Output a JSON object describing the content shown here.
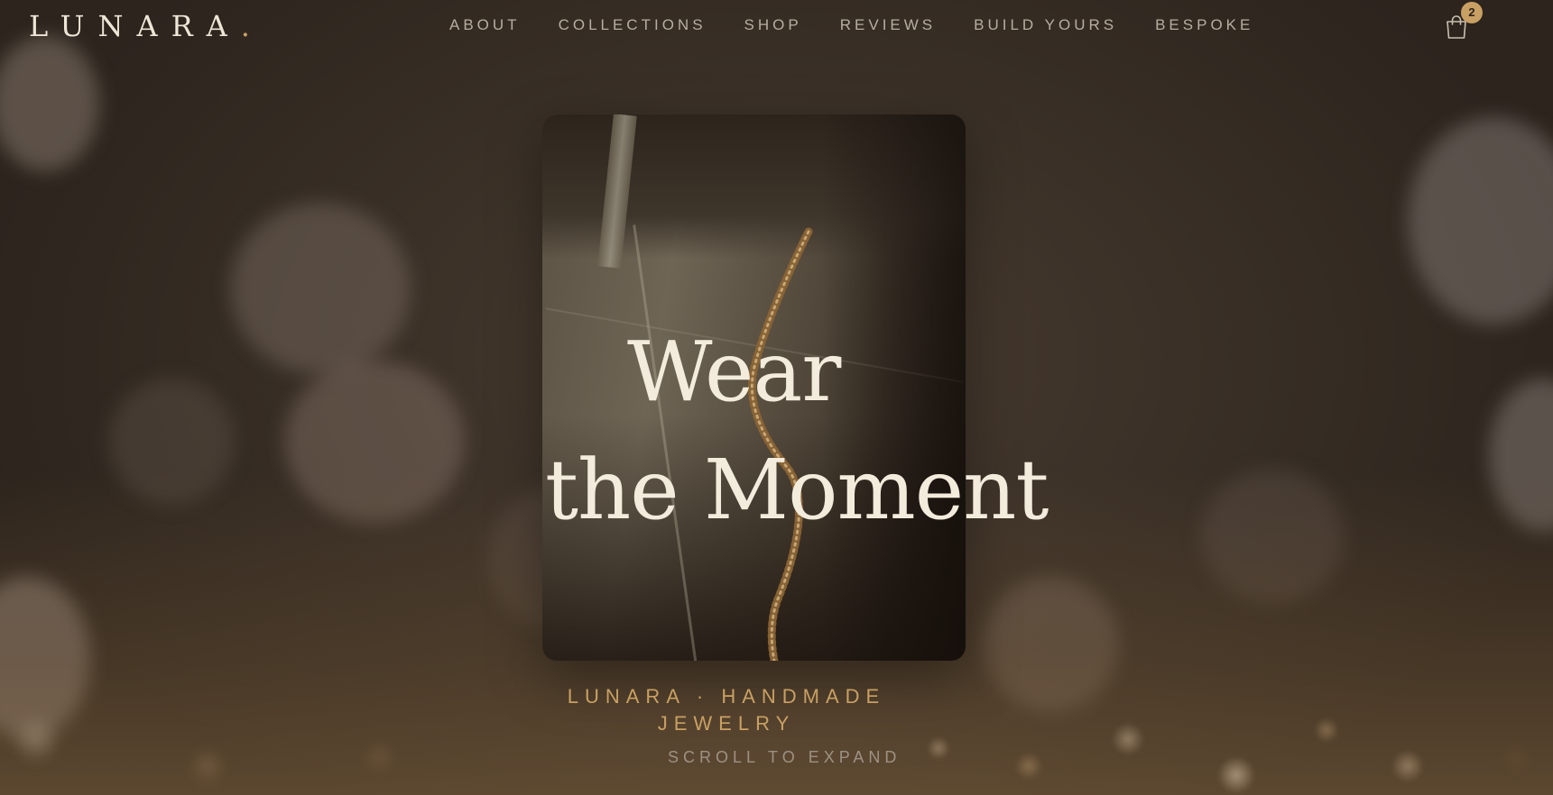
{
  "header": {
    "logo": "LUNARA",
    "logo_dot": ".",
    "nav": [
      {
        "label": "ABOUT"
      },
      {
        "label": "COLLECTIONS"
      },
      {
        "label": "SHOP"
      },
      {
        "label": "REVIEWS"
      },
      {
        "label": "BUILD YOURS"
      },
      {
        "label": "BESPOKE"
      }
    ],
    "cart": {
      "icon": "shopping-bag-icon",
      "count": "2"
    }
  },
  "hero": {
    "headline_line1": "Wear",
    "headline_line2": "the Moment",
    "tagline": "LUNARA · HANDMADE JEWELRY",
    "scroll_hint": "SCROLL TO EXPAND"
  },
  "colors": {
    "accent": "#c9a063",
    "text_light": "#f3ebdc",
    "nav_text": "#b8ada0",
    "background": "#2e2620"
  }
}
